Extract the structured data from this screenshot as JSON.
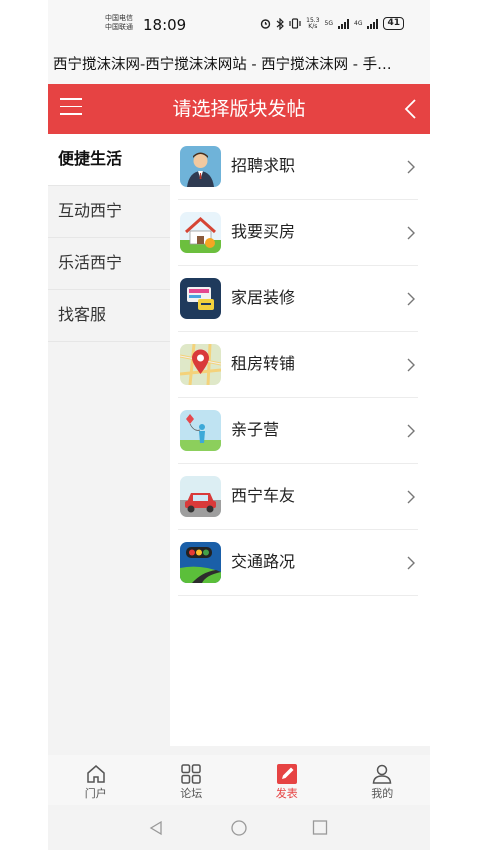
{
  "status_bar": {
    "carrier_1": "中国电信",
    "carrier_2": "中国联通",
    "time": "18:09",
    "speed_value": "15.3",
    "speed_unit": "K/s",
    "net_5g": "5G",
    "net_4g": "4G",
    "battery": "41"
  },
  "page_title": "西宁搅沫沫网-西宁搅沫沫网站 - 西宁搅沫沫网 - 手…",
  "header": {
    "title": "请选择版块发帖",
    "accent_color": "#e64343"
  },
  "sidebar": {
    "items": [
      {
        "label": "便捷生活",
        "active": true
      },
      {
        "label": "互动西宁",
        "active": false
      },
      {
        "label": "乐活西宁",
        "active": false
      },
      {
        "label": "找客服",
        "active": false
      }
    ]
  },
  "boards": [
    {
      "label": "招聘求职",
      "icon": "person-icon"
    },
    {
      "label": "我要买房",
      "icon": "house-icon"
    },
    {
      "label": "家居装修",
      "icon": "decoration-icon"
    },
    {
      "label": "租房转铺",
      "icon": "map-pin-icon"
    },
    {
      "label": "亲子营",
      "icon": "kite-icon"
    },
    {
      "label": "西宁车友",
      "icon": "car-icon"
    },
    {
      "label": "交通路况",
      "icon": "traffic-light-icon"
    }
  ],
  "bottom_nav": {
    "tabs": [
      {
        "label": "门户",
        "icon": "home-icon"
      },
      {
        "label": "论坛",
        "icon": "grid-icon"
      },
      {
        "label": "发表",
        "icon": "edit-icon",
        "active": true
      },
      {
        "label": "我的",
        "icon": "user-icon"
      }
    ]
  }
}
